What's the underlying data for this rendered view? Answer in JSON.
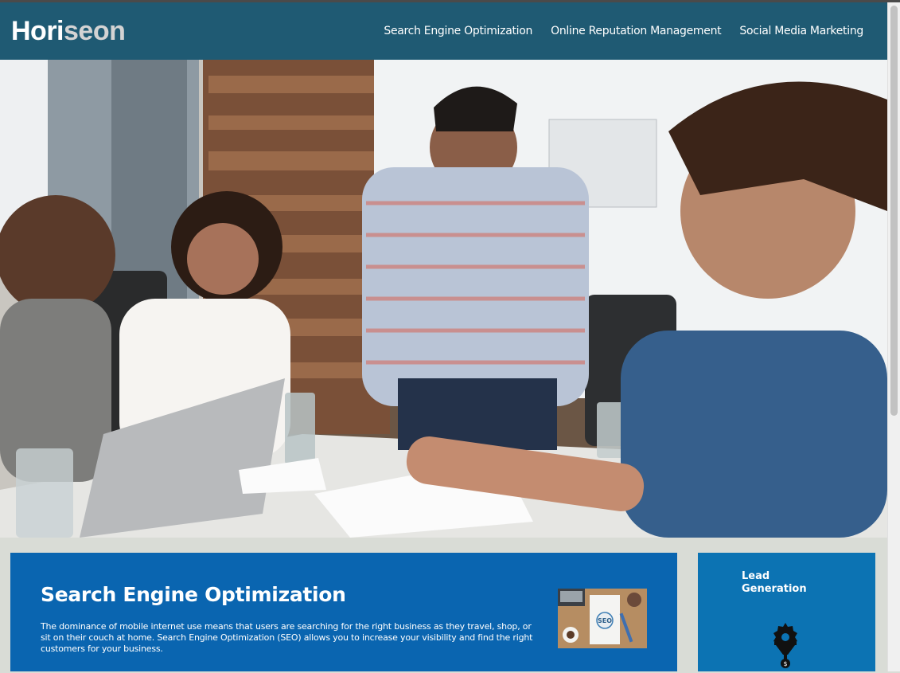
{
  "header": {
    "logo_part1": "Hori",
    "logo_part2": "seon",
    "nav": [
      {
        "label": "Search Engine Optimization"
      },
      {
        "label": "Online Reputation Management"
      },
      {
        "label": "Social Media Marketing"
      }
    ]
  },
  "hero": {
    "image": "team-meeting-photo"
  },
  "seo": {
    "title": "Search Engine Optimization",
    "text": "The dominance of mobile internet use means that users are searching for the right business as they travel, shop, or sit on their couch at home. Search Engine Optimization (SEO) allows you to increase your visibility and find the right customers for your business.",
    "image": "seo-workspace-photo",
    "image_badge": "SEO"
  },
  "lead": {
    "title": "Lead Generation",
    "icon": "lead-generation-icon"
  },
  "colors": {
    "header_bg": "#1f5a73",
    "seo_card_bg": "#0a65b0",
    "lead_card_bg": "#0c73b3",
    "page_bg": "#d9dcd6"
  }
}
